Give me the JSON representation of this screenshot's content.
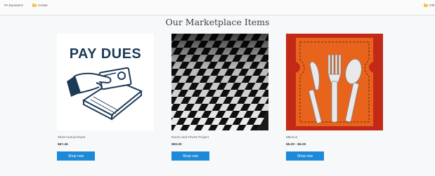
{
  "bookmarks": {
    "items": [
      {
        "label": "PA Dynamics",
        "icon": "page-icon"
      },
      {
        "label": "Create",
        "icon": "folder-icon"
      }
    ],
    "right_label": "Oth",
    "right_icon": "folder-icon"
  },
  "page": {
    "title": "Our Marketplace Items",
    "products": [
      {
        "name": "2019 Annual Dues",
        "price": "$67.45",
        "button_label": "Shop now",
        "image_text": "PAY DUES"
      },
      {
        "name": "Doors and Floors Project",
        "price": "$50.00",
        "button_label": "Shop now",
        "image_alt": "checkered-floor-image"
      },
      {
        "name": "MEALS",
        "price": "$5.00 - $6.00",
        "button_label": "Shop now",
        "image_alt": "meals-cutlery-image"
      }
    ]
  },
  "colors": {
    "button": "#1d8ad8",
    "background": "#f6f8f9",
    "meals_bg": "#e8641c",
    "meals_border": "#c22a17",
    "dues_ink": "#1d3b57"
  }
}
